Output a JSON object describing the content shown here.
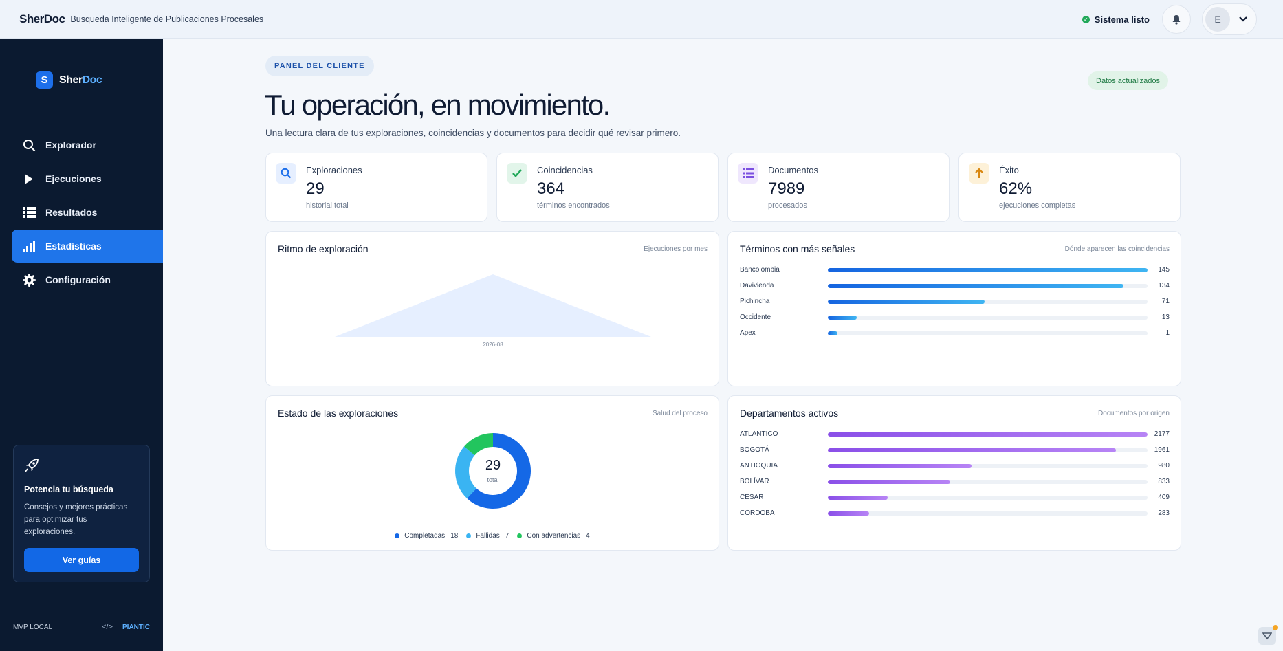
{
  "topbar": {
    "brand": "SherDoc",
    "subtitle": "Busqueda Inteligente de Publicaciones Procesales",
    "status": "Sistema listo",
    "user_initial": "E"
  },
  "sidebar": {
    "logo_letter": "S",
    "logo_part1": "Sher",
    "logo_part2": "Doc",
    "nav": [
      {
        "label": "Explorador",
        "icon": "search-icon"
      },
      {
        "label": "Ejecuciones",
        "icon": "play-icon"
      },
      {
        "label": "Resultados",
        "icon": "list-icon"
      },
      {
        "label": "Estadísticas",
        "icon": "bar-chart-icon",
        "active": true
      },
      {
        "label": "Configuración",
        "icon": "gear-icon"
      }
    ],
    "promo": {
      "title": "Potencia tu búsqueda",
      "desc": "Consejos y mejores prácticas para optimizar tus exploraciones.",
      "button": "Ver guías"
    },
    "footer_left": "MVP LOCAL",
    "footer_right": "PIANTIC"
  },
  "header": {
    "pill": "PANEL DEL CLIENTE",
    "updated": "Datos actualizados",
    "title": "Tu operación, en movimiento.",
    "subtitle": "Una lectura clara de tus exploraciones, coincidencias y documentos para decidir qué revisar primero."
  },
  "kpis": [
    {
      "label": "Exploraciones",
      "value": "29",
      "sub": "historial total",
      "icon": "search-icon",
      "color": "#1d6fea",
      "bg": "#e6efff"
    },
    {
      "label": "Coincidencias",
      "value": "364",
      "sub": "términos encontrados",
      "icon": "check-icon",
      "color": "#22a85a",
      "bg": "#e2f5ea"
    },
    {
      "label": "Documentos",
      "value": "7989",
      "sub": "procesados",
      "icon": "list-icon",
      "color": "#7b4fe0",
      "bg": "#efe7fd"
    },
    {
      "label": "Éxito",
      "value": "62%",
      "sub": "ejecuciones completas",
      "icon": "arrow-up-icon",
      "color": "#d9870f",
      "bg": "#fdf1d8"
    }
  ],
  "ritmo": {
    "title": "Ritmo de exploración",
    "aside": "Ejecuciones por mes"
  },
  "terminos": {
    "title": "Términos con más señales",
    "aside": "Dónde aparecen las coincidencias"
  },
  "estado": {
    "title": "Estado de las exploraciones",
    "aside": "Salud del proceso",
    "total": "29",
    "total_label": "total"
  },
  "departamentos": {
    "title": "Departamentos activos",
    "aside": "Documentos por origen"
  },
  "chart_data": [
    {
      "type": "area",
      "title": "Ritmo de exploración",
      "categories": [
        "2026-08"
      ],
      "values": [
        29
      ]
    },
    {
      "type": "bar",
      "title": "Términos con más señales",
      "categories": [
        "Bancolombia",
        "Davivienda",
        "Pichincha",
        "Occidente",
        "Apex"
      ],
      "values": [
        145,
        134,
        71,
        13,
        1
      ]
    },
    {
      "type": "pie",
      "title": "Estado de las exploraciones",
      "categories": [
        "Completadas",
        "Fallidas",
        "Con advertencias"
      ],
      "values": [
        18,
        7,
        4
      ],
      "colors": [
        "#1568e6",
        "#3ab4f2",
        "#22c55e"
      ]
    },
    {
      "type": "bar",
      "title": "Departamentos activos",
      "categories": [
        "ATLÁNTICO",
        "BOGOTÁ",
        "ANTIOQUIA",
        "BOLÍVAR",
        "CESAR",
        "CÓRDOBA"
      ],
      "values": [
        2177,
        1961,
        980,
        833,
        409,
        283
      ]
    }
  ]
}
